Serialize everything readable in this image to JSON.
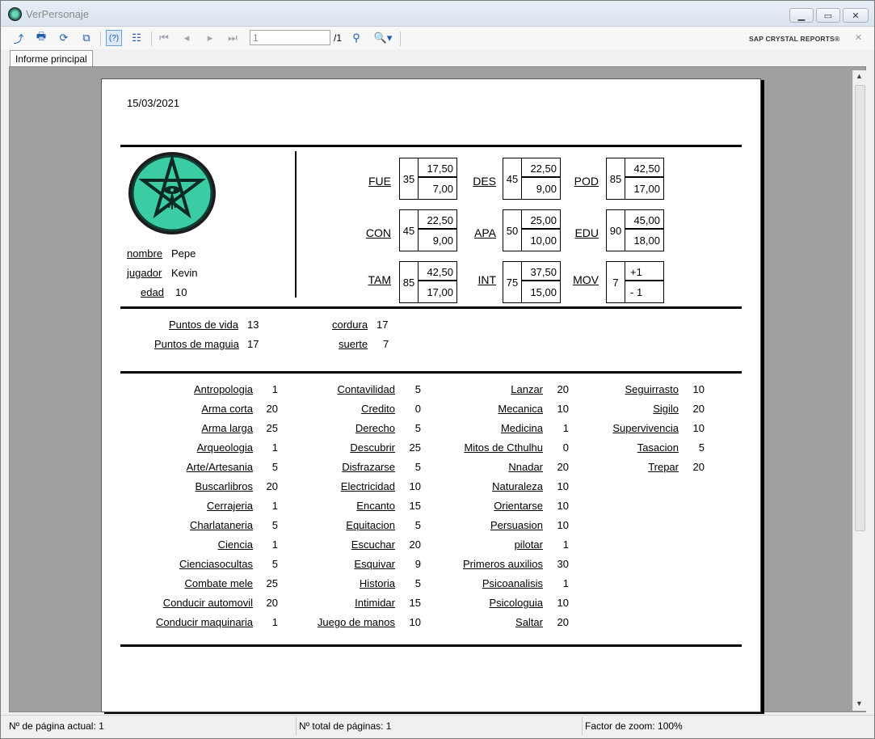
{
  "window": {
    "title": "VerPersonaje"
  },
  "toolbar": {
    "page_value": "1",
    "page_total": "/1",
    "brand": "SAP CRYSTAL REPORTS®"
  },
  "tabs": [
    {
      "label": "Informe principal"
    }
  ],
  "report": {
    "date": "15/03/2021",
    "character": {
      "name_label": "nombre",
      "name": "Pepe",
      "player_label": "jugador",
      "player": "Kevin",
      "age_label": "edad",
      "age": "10"
    },
    "stats": [
      {
        "label": "FUE",
        "value": "35",
        "half": "17,50",
        "fifth": "7,00"
      },
      {
        "label": "DES",
        "value": "45",
        "half": "22,50",
        "fifth": "9,00"
      },
      {
        "label": "POD",
        "value": "85",
        "half": "42,50",
        "fifth": "17,00"
      },
      {
        "label": "CON",
        "value": "45",
        "half": "22,50",
        "fifth": "9,00"
      },
      {
        "label": "APA",
        "value": "50",
        "half": "25,00",
        "fifth": "10,00"
      },
      {
        "label": "EDU",
        "value": "90",
        "half": "45,00",
        "fifth": "18,00"
      },
      {
        "label": "TAM",
        "value": "85",
        "half": "42,50",
        "fifth": "17,00"
      },
      {
        "label": "INT",
        "value": "75",
        "half": "37,50",
        "fifth": "15,00"
      },
      {
        "label": "MOV",
        "value": "7",
        "half": "+1",
        "fifth": "- 1"
      }
    ],
    "derived": {
      "hp_label": "Puntos de vida",
      "hp": "13",
      "mp_label": "Puntos de maguia",
      "mp": "17",
      "sanity_label": "cordura",
      "sanity": "17",
      "luck_label": "suerte",
      "luck": "7"
    },
    "skills_col1": [
      {
        "name": "Antropologia",
        "value": "1"
      },
      {
        "name": "Arma corta",
        "value": "20"
      },
      {
        "name": "Arma larga",
        "value": "25"
      },
      {
        "name": "Arqueologia",
        "value": "1"
      },
      {
        "name": "Arte/Artesania",
        "value": "5"
      },
      {
        "name": "Buscarlibros",
        "value": "20"
      },
      {
        "name": "Cerrajeria",
        "value": "1"
      },
      {
        "name": "Charlataneria",
        "value": "5"
      },
      {
        "name": "Ciencia",
        "value": "1"
      },
      {
        "name": "Cienciasocultas",
        "value": "5"
      },
      {
        "name": "Combate mele",
        "value": "25"
      },
      {
        "name": "Conducir automovil",
        "value": "20"
      },
      {
        "name": "Conducir maquinaria",
        "value": "1"
      }
    ],
    "skills_col2": [
      {
        "name": "Contavilidad",
        "value": "5"
      },
      {
        "name": "Credito",
        "value": "0"
      },
      {
        "name": "Derecho",
        "value": "5"
      },
      {
        "name": "Descubrir",
        "value": "25"
      },
      {
        "name": "Disfrazarse",
        "value": "5"
      },
      {
        "name": "Electricidad",
        "value": "10"
      },
      {
        "name": "Encanto",
        "value": "15"
      },
      {
        "name": "Equitacion",
        "value": "5"
      },
      {
        "name": "Escuchar",
        "value": "20"
      },
      {
        "name": "Esquivar",
        "value": "9"
      },
      {
        "name": "Historia",
        "value": "5"
      },
      {
        "name": "Intimidar",
        "value": "15"
      },
      {
        "name": "Juego de manos",
        "value": "10"
      }
    ],
    "skills_col3": [
      {
        "name": "Lanzar",
        "value": "20"
      },
      {
        "name": "Mecanica",
        "value": "10"
      },
      {
        "name": "Medicina",
        "value": "1"
      },
      {
        "name": "Mitos de Cthulhu",
        "value": "0"
      },
      {
        "name": "Nnadar",
        "value": "20"
      },
      {
        "name": "Naturaleza",
        "value": "10"
      },
      {
        "name": "Orientarse",
        "value": "10"
      },
      {
        "name": "Persuasion",
        "value": "10"
      },
      {
        "name": "pilotar",
        "value": "1"
      },
      {
        "name": "Primeros auxilios",
        "value": "30"
      },
      {
        "name": "Psicoanalisis",
        "value": "1"
      },
      {
        "name": "Psicologuia",
        "value": "10"
      },
      {
        "name": "Saltar",
        "value": "20"
      }
    ],
    "skills_col4": [
      {
        "name": "Seguirrasto",
        "value": "10"
      },
      {
        "name": "Sigilo",
        "value": "20"
      },
      {
        "name": "Supervivencia",
        "value": "10"
      },
      {
        "name": "Tasacion",
        "value": "5"
      },
      {
        "name": "Trepar",
        "value": "20"
      }
    ]
  },
  "status": {
    "current_page": "Nº de página actual: 1",
    "total_pages": "Nº total de páginas: 1",
    "zoom": "Factor de zoom: 100%"
  }
}
